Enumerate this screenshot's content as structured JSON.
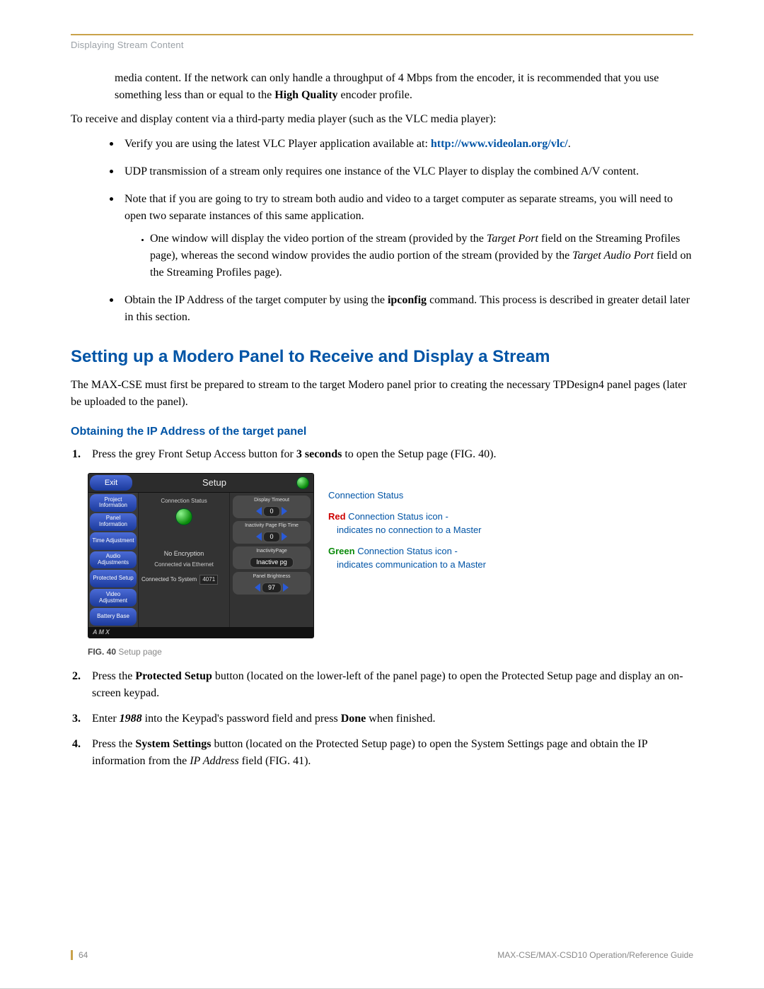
{
  "header": {
    "section": "Displaying Stream Content"
  },
  "intro": {
    "cont_para": "media content. If the network can only handle a throughput of 4 Mbps from the encoder, it is recommended that you use something less than or equal to the ",
    "hq_bold": "High Quality",
    "cont_para_end": " encoder profile.",
    "receive_line": "To receive and display content via a third-party media player (such as the VLC media player):"
  },
  "bullets": {
    "b1a": "Verify you are using the latest VLC Player application available at: ",
    "b1_link": "http://www.videolan.org/vlc/",
    "b1_end": ".",
    "b2": "UDP transmission of a stream only requires one instance of the VLC Player to display the combined A/V content.",
    "b3": "Note that if you are going to try to stream both audio and video to a target computer as separate streams, you will need to open two separate instances of this same application.",
    "b3_sub_a": "One window will display the video portion of the stream (provided by the ",
    "b3_sub_tp": "Target Port",
    "b3_sub_b": " field on the Streaming Profiles page), whereas the second window provides the audio portion of the stream (provided by the ",
    "b3_sub_tap": "Target Audio Port",
    "b3_sub_c": " field on the Streaming Profiles page).",
    "b4a": "Obtain the IP Address of the target computer by using the ",
    "b4_bold": "ipconfig",
    "b4b": " command. This process is described in greater detail later in this section."
  },
  "section_heading": "Setting up a Modero Panel to Receive and Display a Stream",
  "section_para": "The MAX-CSE must first be prepared to stream to the target Modero panel prior to creating the necessary TPDesign4 panel pages (later be uploaded to the panel).",
  "subsection_heading": "Obtaining the IP Address of the target panel",
  "steps": {
    "s1a": "Press the grey Front Setup Access button for ",
    "s1_bold": "3 seconds",
    "s1b": " to open the Setup page (FIG. 40).",
    "s2a": "Press the ",
    "s2_bold": "Protected Setup",
    "s2b": " button (located on the lower-left of the panel page) to open the Protected Setup page and display an on-screen keypad.",
    "s3a": "Enter ",
    "s3_italic": "1988",
    "s3b": " into the Keypad's password field and press ",
    "s3_bold": "Done",
    "s3c": " when finished.",
    "s4a": "Press the ",
    "s4_bold": "System Settings",
    "s4b": " button (located on the Protected Setup page) to open the System Settings page and obtain the IP information from the ",
    "s4_italic": "IP Address",
    "s4c": " field (FIG. 41)."
  },
  "panel": {
    "exit": "Exit",
    "title": "Setup",
    "left_buttons": [
      "Project Information",
      "Panel Information",
      "Time Adjustment",
      "Audio Adjustments",
      "Protected Setup",
      "Video Adjustment",
      "Battery Base"
    ],
    "mid_status_label": "Connection Status",
    "mid_noenc": "No Encryption",
    "mid_conn": "Connected via Ethernet",
    "mid_sys_label": "Connected To System",
    "mid_sys_val": "4071",
    "right_groups": [
      {
        "title": "Display Timeout",
        "val": "0"
      },
      {
        "title": "Inactivity Page Flip Time",
        "val": "0"
      },
      {
        "title": "InactivityPage",
        "val": "Inactive pg"
      },
      {
        "title": "Panel Brightness",
        "val": "97"
      }
    ],
    "footer_logo": "AMX"
  },
  "callout": {
    "title": "Connection Status",
    "red_lead": "Red",
    "red_rest": " Connection Status icon -",
    "red_desc": "indicates no connection to a Master",
    "green_lead": "Green",
    "green_rest": " Connection Status icon -",
    "green_desc": "indicates communication to a Master"
  },
  "figure": {
    "label_bold": "FIG. 40",
    "label_text": "  Setup page"
  },
  "footer": {
    "page_num": "64",
    "guide": "MAX-CSE/MAX-CSD10 Operation/Reference Guide"
  }
}
